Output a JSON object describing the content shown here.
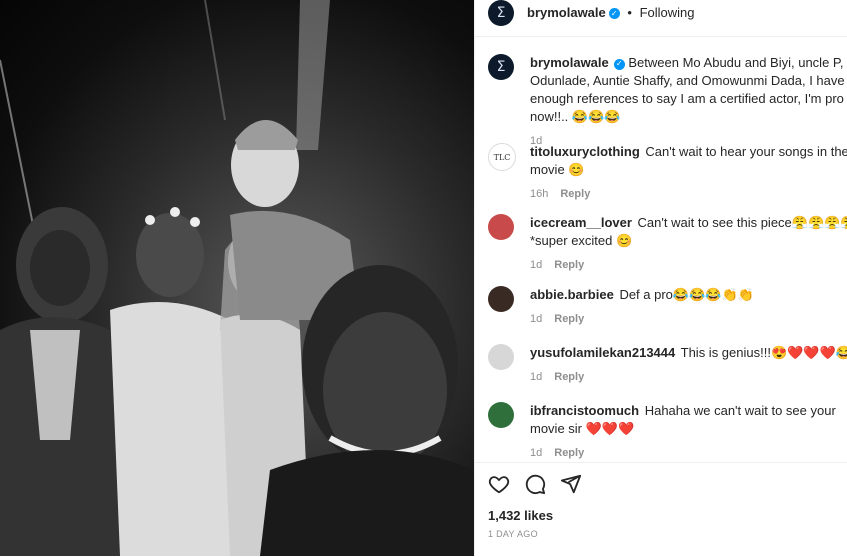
{
  "post": {
    "author": "brymolawale",
    "follow_label": "Following",
    "separator": "•",
    "avatar_glyph": "Σ",
    "verified_glyph": "✓",
    "caption": {
      "text": "Between Mo Abudu and Biyi, uncle P, Odunlade, Auntie Shaffy, and Omowunmi Dada, I have enough references to say I am a certified actor, I'm pro now!!.. 😂😂😂",
      "age": "1d"
    },
    "comments": [
      {
        "user": "titoluxuryclothing",
        "avatar_text": "TLC",
        "text": "Can't wait to hear your songs in the movie 😊",
        "age": "16h",
        "reply_label": "Reply"
      },
      {
        "user": "icecream__lover",
        "avatar_text": "",
        "text": "Can't wait to see this piece😤😤😤😤 *super excited 😊",
        "age": "1d",
        "reply_label": "Reply"
      },
      {
        "user": "abbie.barbiee",
        "avatar_text": "",
        "text": "Def a pro😂😂😂👏👏",
        "age": "1d",
        "reply_label": "Reply"
      },
      {
        "user": "yusufolamilekan213444",
        "avatar_text": "",
        "text": "This is genius!!!😍❤️❤️❤️😂",
        "age": "1d",
        "reply_label": "Reply"
      },
      {
        "user": "ibfrancistoomuch",
        "avatar_text": "",
        "text": "Hahaha we can't wait to see your movie sir ❤️❤️❤️",
        "age": "1d",
        "reply_label": "Reply"
      }
    ],
    "likes": "1,432 likes",
    "posted": "1 DAY AGO"
  },
  "icons": [
    "heart-icon",
    "comment-icon",
    "share-icon"
  ],
  "colors": {
    "verified": "#0095f6",
    "muted": "#8e8e8e",
    "text": "#262626"
  }
}
